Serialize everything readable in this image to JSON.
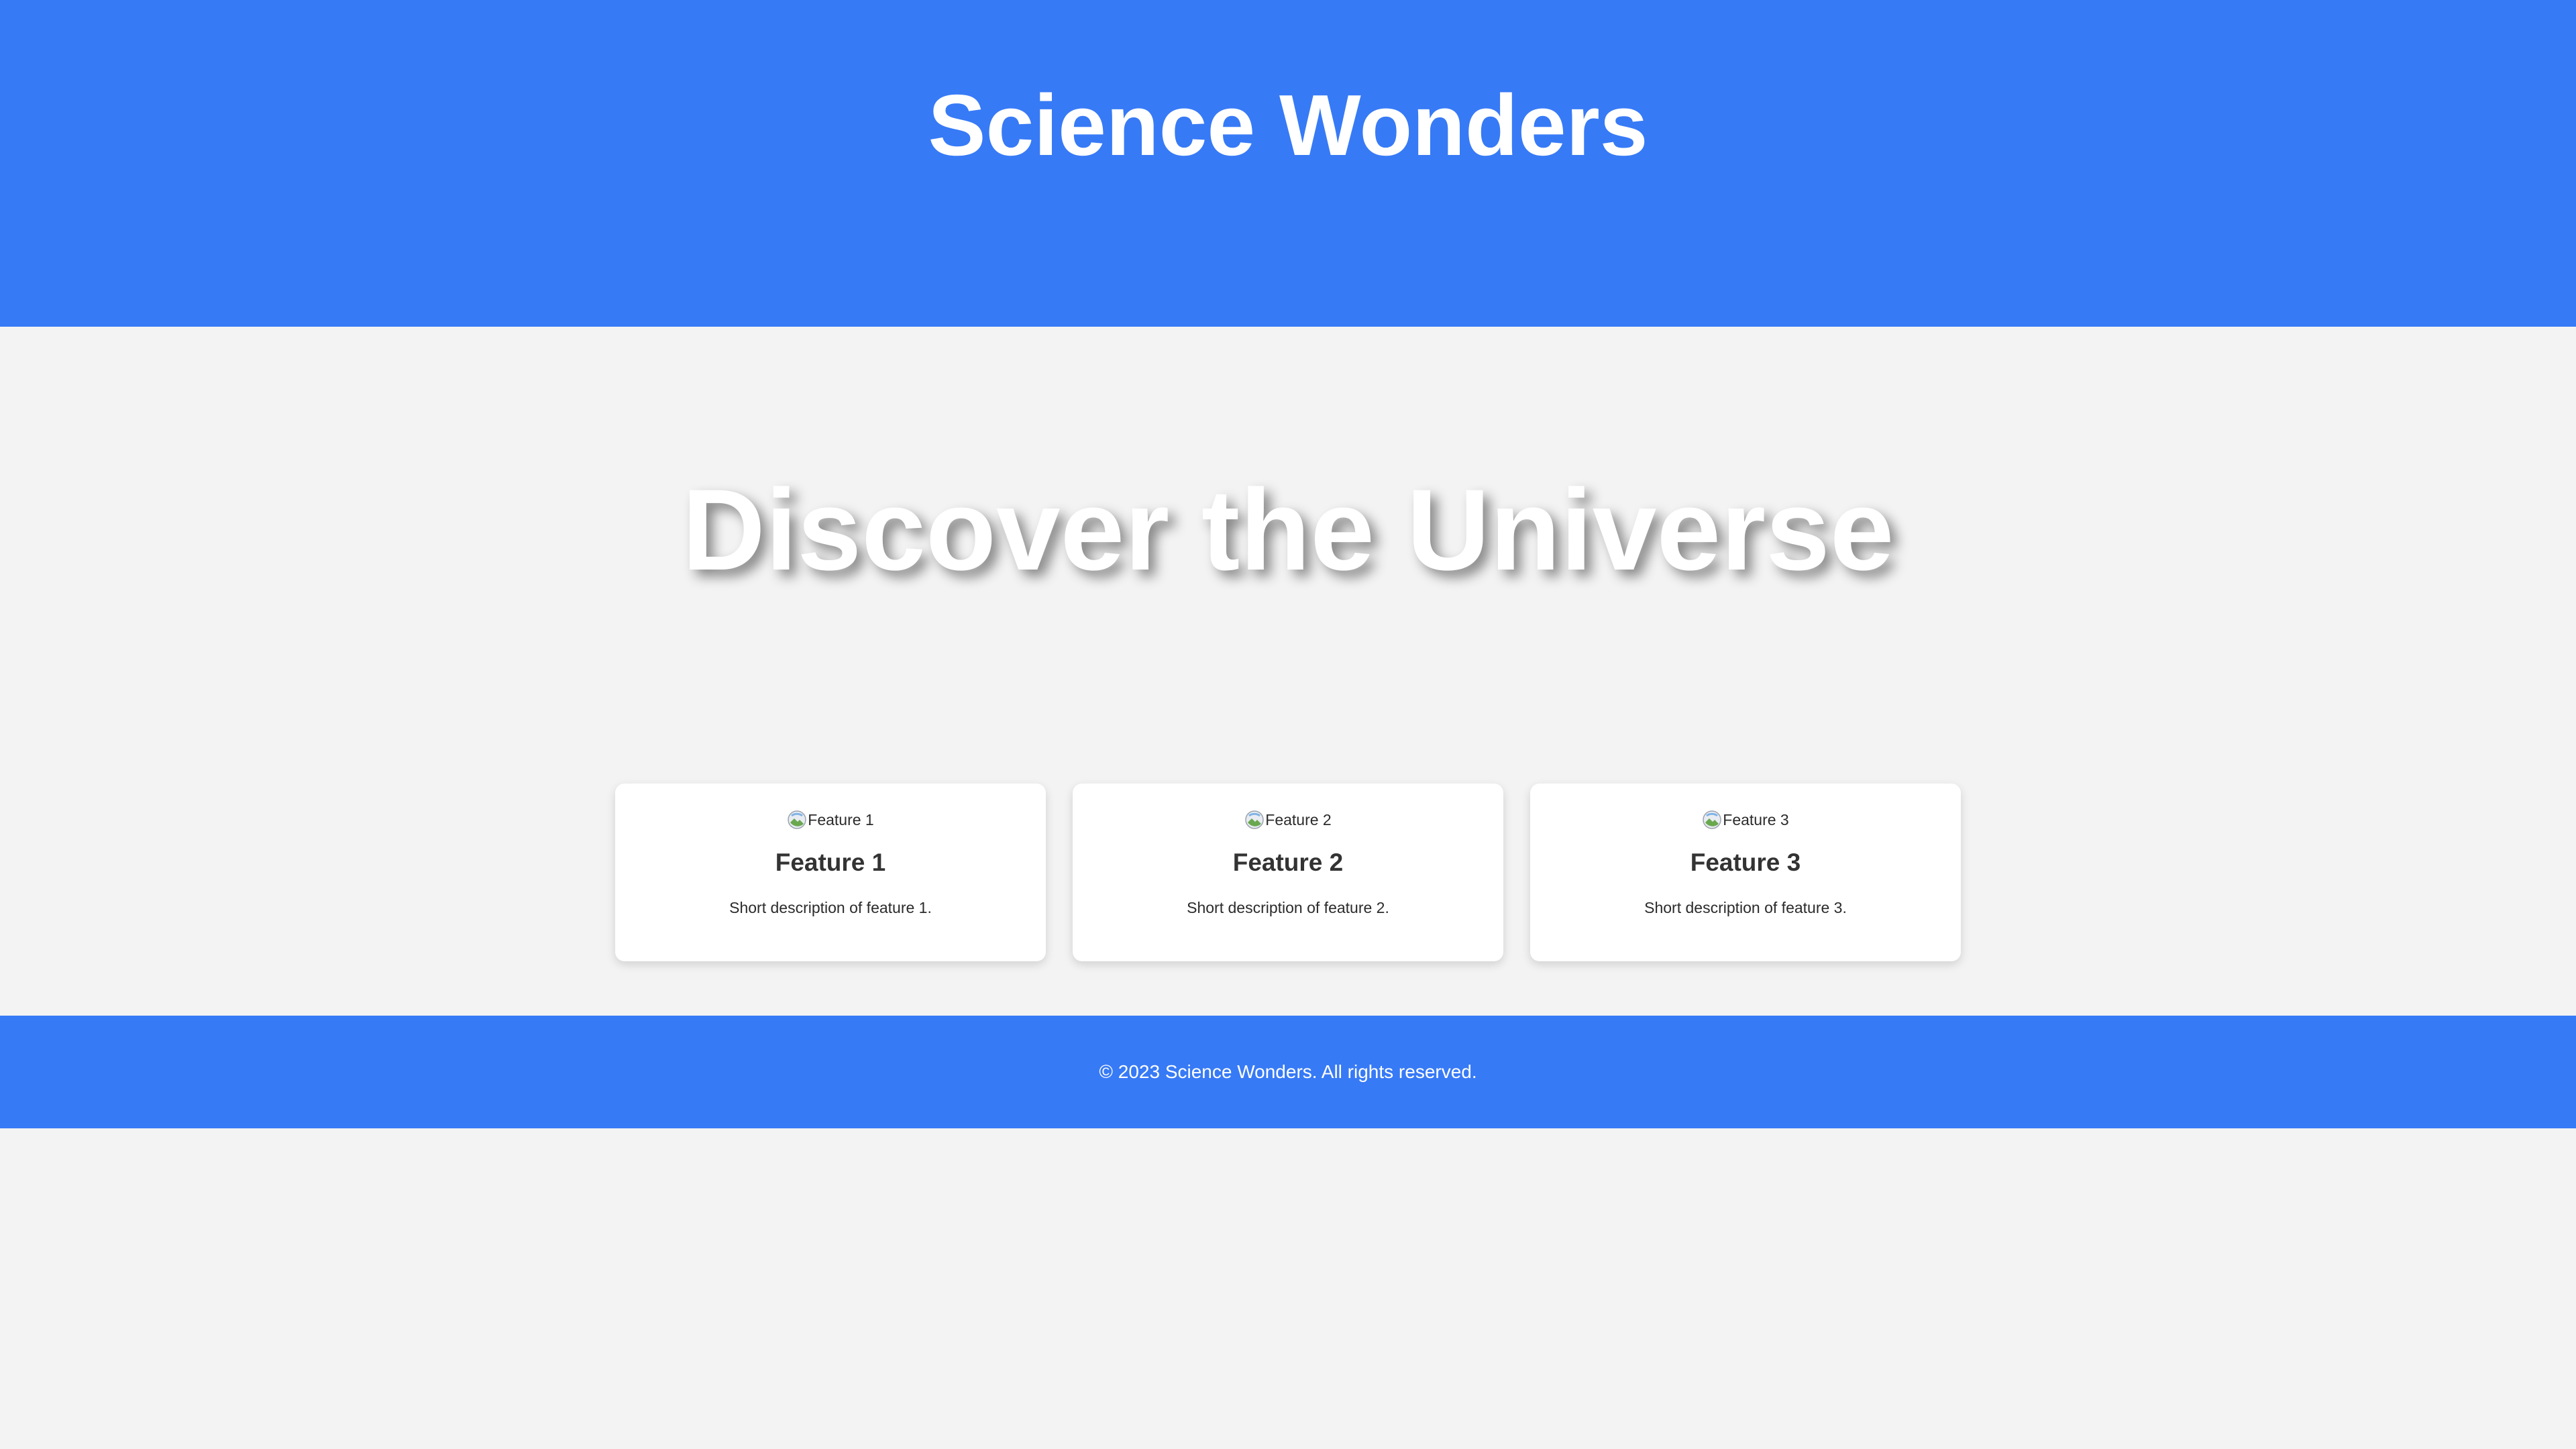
{
  "header": {
    "title": "Science Wonders"
  },
  "hero": {
    "title": "Discover the Universe"
  },
  "features": [
    {
      "img_alt": "Feature 1",
      "icon": "broken-image-icon",
      "title": "Feature 1",
      "description": "Short description of feature 1."
    },
    {
      "img_alt": "Feature 2",
      "icon": "broken-image-icon",
      "title": "Feature 2",
      "description": "Short description of feature 2."
    },
    {
      "img_alt": "Feature 3",
      "icon": "broken-image-icon",
      "title": "Feature 3",
      "description": "Short description of feature 3."
    }
  ],
  "footer": {
    "text": "© 2023 Science Wonders. All rights reserved."
  },
  "colors": {
    "brand": "#377af6",
    "background": "#f3f3f3",
    "card": "#ffffff"
  }
}
